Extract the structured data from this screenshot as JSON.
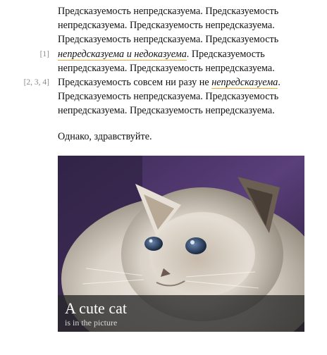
{
  "paragraph1": {
    "lines": [
      {
        "note": "",
        "before": "Предсказуемость непредсказуема. Предсказуемость",
        "highlight": "",
        "after": ""
      },
      {
        "note": "",
        "before": "непредсказуема. Предсказуемость непредсказуема.",
        "highlight": "",
        "after": ""
      },
      {
        "note": "",
        "before": "Предсказуемость непредсказуема. Предсказуемость",
        "highlight": "",
        "after": ""
      },
      {
        "note": "[1]",
        "before": "",
        "highlight": "непредсказуема и недоказуема",
        "after": ". Предсказуемость"
      },
      {
        "note": "",
        "before": "непредсказуема. Предсказуемость непредсказуема.",
        "highlight": "",
        "after": ""
      },
      {
        "note": "[2, 3, 4]",
        "before": "Предсказуемость совсем ни разу не ",
        "highlight": "непредсказуема",
        "after": "."
      },
      {
        "note": "",
        "before": "Предсказуемость непредсказуема. Предсказуемость",
        "highlight": "",
        "after": ""
      },
      {
        "note": "",
        "before": "непредсказуема. Предсказуемость непредсказуема.",
        "highlight": "",
        "after": ""
      }
    ]
  },
  "paragraph2": {
    "text": "Однако, здравствуйте."
  },
  "figure": {
    "caption_title": "A cute cat",
    "caption_subtitle": "is in the picture"
  },
  "colors": {
    "highlight_underline": "#e8b232",
    "note_text": "#8a8a8a",
    "caption_bg": "#282828"
  },
  "icons": {
    "image": "cat-photo"
  }
}
